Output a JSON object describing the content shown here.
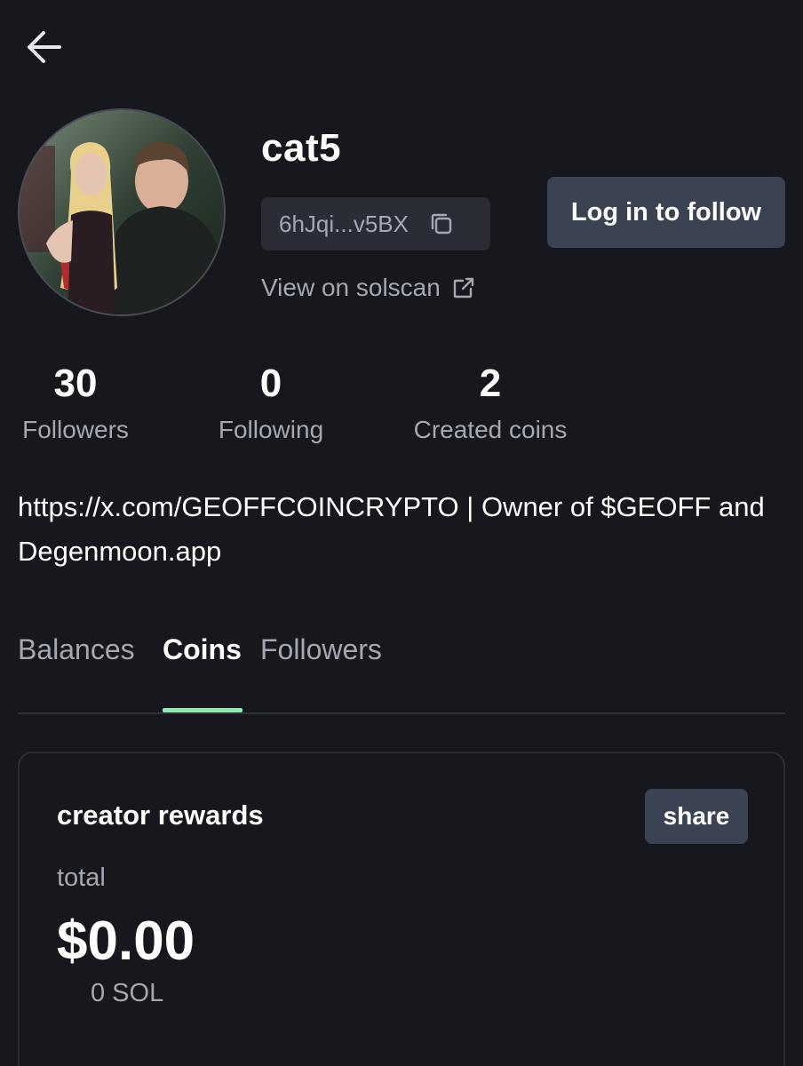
{
  "nav": {
    "back_icon": "arrow-left-icon"
  },
  "profile": {
    "username": "cat5",
    "address_short": "6hJqi...v5BX",
    "copy_icon": "copy-icon",
    "solscan_label": "View on solscan",
    "external_icon": "external-link-icon",
    "follow_button": "Log in to follow",
    "bio": "https://x.com/GEOFFCOINCRYPTO | Owner of $GEOFF and Degenmoon.app"
  },
  "stats": {
    "followers": {
      "value": "30",
      "label": "Followers"
    },
    "following": {
      "value": "0",
      "label": "Following"
    },
    "created": {
      "value": "2",
      "label": "Created coins"
    }
  },
  "tabs": [
    {
      "label": "Balances",
      "active": false
    },
    {
      "label": "Coins",
      "active": true
    },
    {
      "label": "Followers",
      "active": false
    }
  ],
  "rewards": {
    "title": "creator rewards",
    "share_label": "share",
    "total_label": "total",
    "total_usd": "$0.00",
    "total_sol": "0 SOL"
  },
  "colors": {
    "background": "#17181d",
    "button": "#3b4252",
    "muted_text": "#a3a8b3",
    "tab_indicator": "#86efac"
  }
}
